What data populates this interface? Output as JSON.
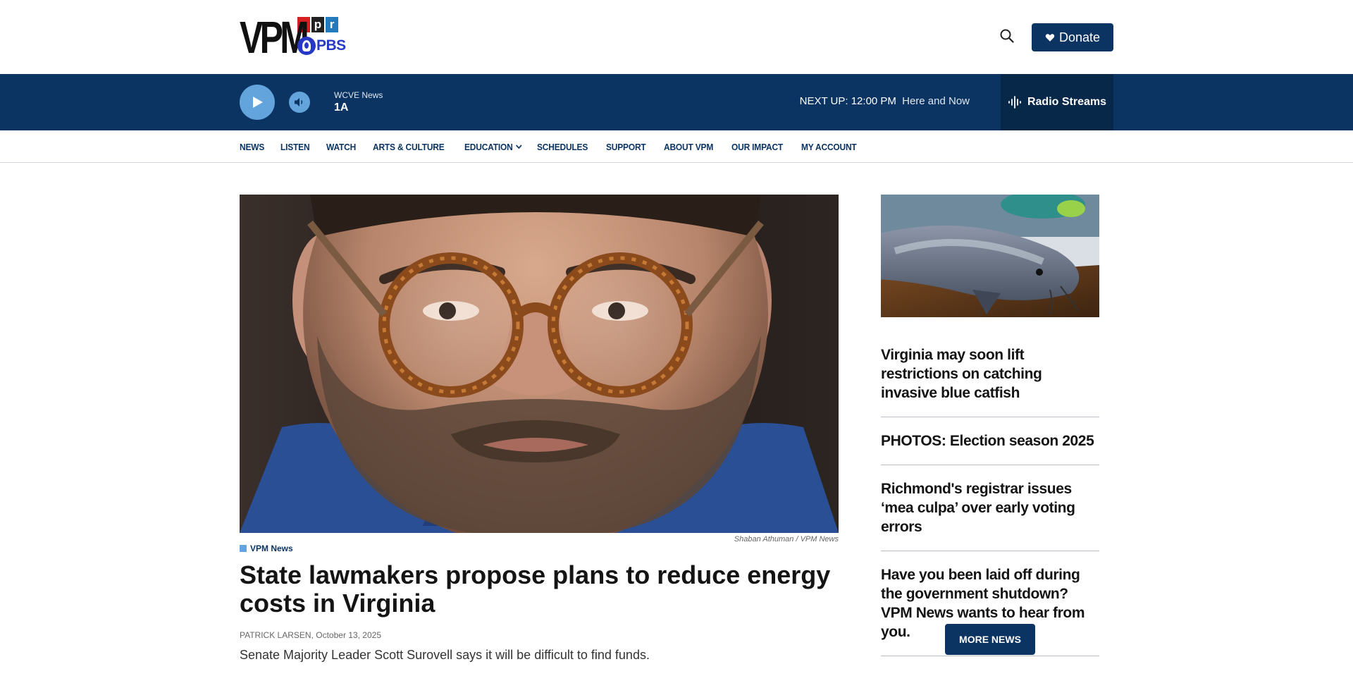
{
  "header": {
    "logo_text": "VPM",
    "logo_npr": [
      "n",
      "p",
      "r"
    ],
    "logo_pbs": "PBS",
    "donate_label": "Donate"
  },
  "player": {
    "station": "WCVE News",
    "program": "1A",
    "next_up_label": "NEXT UP:",
    "next_up_time": "12:00 PM",
    "next_up_show": "Here and Now",
    "streams_label": "Radio Streams"
  },
  "nav": {
    "items": [
      "NEWS",
      "LISTEN",
      "WATCH",
      "ARTS & CULTURE",
      "EDUCATION",
      "SCHEDULES",
      "SUPPORT",
      "ABOUT VPM",
      "OUR IMPACT",
      "MY ACCOUNT"
    ]
  },
  "article": {
    "photo_credit": "Shaban Athuman",
    "photo_source": "VPM News",
    "tag": "VPM News",
    "headline": "State lawmakers propose plans to reduce energy costs in Virginia",
    "author": "Patrick Larsen,",
    "date": "October 13, 2025",
    "summary": "Senate Majority Leader Scott Surovell says it will be difficult to find funds."
  },
  "sidebar": {
    "items": [
      "Virginia may soon lift restrictions on catching invasive blue catfish",
      "PHOTOS: Election season 2025",
      "Richmond's registrar issues ‘mea culpa’ over early voting errors",
      "Have you been laid off during the government shutdown? VPM News wants to hear from you."
    ],
    "more_label": "MORE NEWS"
  },
  "colors": {
    "brand_navy": "#0b3463",
    "accent_blue": "#63a4dd",
    "streams_bg": "#072849"
  },
  "icons": {
    "search": "search-icon",
    "donate": "heart-icon",
    "play": "play-icon",
    "volume": "volume-icon",
    "streams": "audio-wave-icon",
    "dropdown": "chevron-down-icon"
  }
}
